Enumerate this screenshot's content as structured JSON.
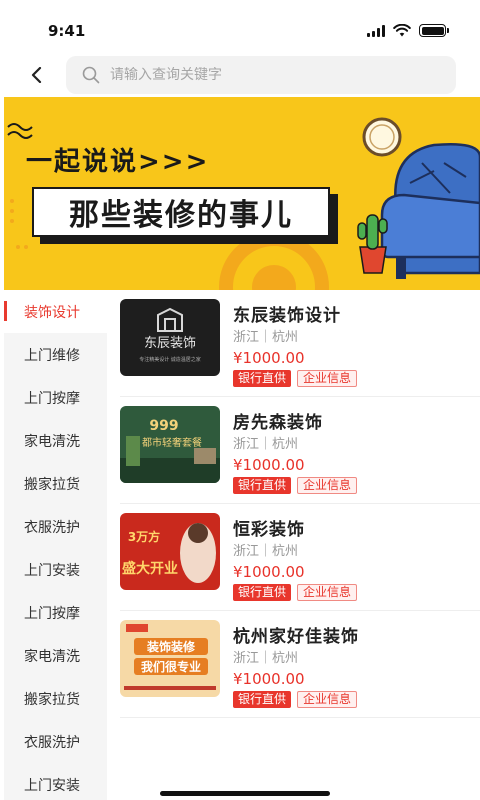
{
  "status_bar": {
    "time": "9:41"
  },
  "search": {
    "placeholder": "请输入查询关键字"
  },
  "banner": {
    "line1": "一起说说>>>",
    "line2": "那些装修的事儿"
  },
  "sidebar": {
    "items": [
      {
        "label": "装饰设计"
      },
      {
        "label": "上门维修"
      },
      {
        "label": "上门按摩"
      },
      {
        "label": "家电清洗"
      },
      {
        "label": "搬家拉货"
      },
      {
        "label": "衣服洗护"
      },
      {
        "label": "上门安装"
      },
      {
        "label": "上门按摩"
      },
      {
        "label": "家电清洗"
      },
      {
        "label": "搬家拉货"
      },
      {
        "label": "衣服洗护"
      },
      {
        "label": "上门安装"
      }
    ]
  },
  "stores": [
    {
      "name": "东辰装饰设计",
      "location": "浙江｜杭州",
      "price": "¥1000.00",
      "tag_bank": "银行直供",
      "tag_info": "企业信息",
      "thumb": {
        "text": "东辰装饰",
        "sub": "专注精美设计  诚造温居之家"
      }
    },
    {
      "name": "房先森装饰",
      "location": "浙江｜杭州",
      "price": "¥1000.00",
      "tag_bank": "银行直供",
      "tag_info": "企业信息",
      "thumb": {
        "text": "999",
        "sub": "都市轻奢套餐"
      }
    },
    {
      "name": "恒彩装饰",
      "location": "浙江｜杭州",
      "price": "¥1000.00",
      "tag_bank": "银行直供",
      "tag_info": "企业信息",
      "thumb": {
        "text": "3万方",
        "sub": "盛大开业"
      }
    },
    {
      "name": "杭州家好佳装饰",
      "location": "浙江｜杭州",
      "price": "¥1000.00",
      "tag_bank": "银行直供",
      "tag_info": "企业信息",
      "thumb": {
        "text": "装饰装修",
        "sub": "我们很专业"
      }
    }
  ],
  "colors": {
    "accent": "#e8322a",
    "banner_bg": "#f8c61a"
  }
}
